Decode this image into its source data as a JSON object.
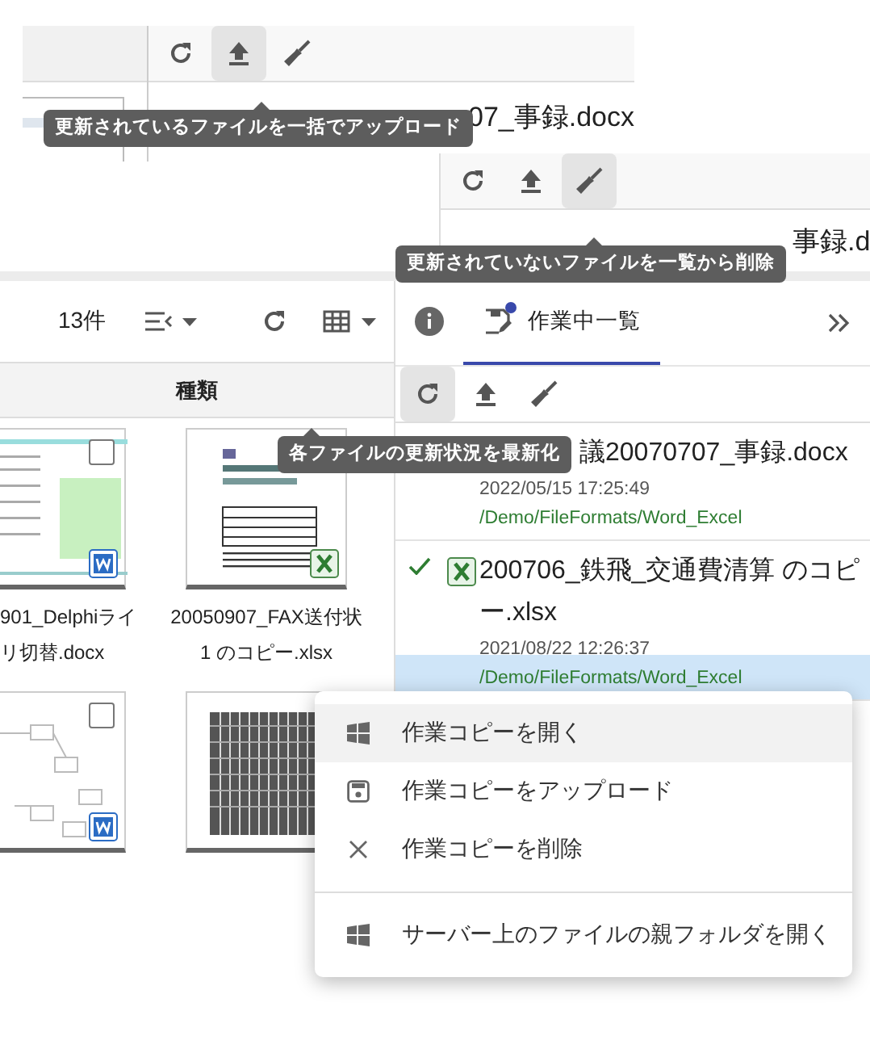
{
  "upload_panel": {
    "toolbar": [
      {
        "kind": "refresh",
        "hovered": false
      },
      {
        "kind": "upload",
        "hovered": true
      },
      {
        "kind": "clean",
        "hovered": false
      }
    ],
    "row_name": "07_事録.docx",
    "tooltip": "更新されているファイルを一括でアップロード"
  },
  "clean_panel": {
    "toolbar": [
      {
        "kind": "refresh",
        "hovered": false
      },
      {
        "kind": "upload",
        "hovered": false
      },
      {
        "kind": "clean",
        "hovered": true
      }
    ],
    "row_name": "事録.d",
    "tooltip": "更新されていないファイルを一覧から削除"
  },
  "file_browser": {
    "count": "13件",
    "column_header": "種類",
    "files": [
      {
        "name_lines": [
          "901_Delphiライ",
          "リ切替.docx"
        ],
        "kind": "word_document",
        "checked": false
      },
      {
        "name_lines": [
          "20050907_FAX送付状",
          "1 のコピー.xlsx"
        ],
        "kind": "excel_form"
      },
      {
        "kind": "word_diagram",
        "checked": false
      },
      {
        "kind": "spreadsheet"
      }
    ]
  },
  "side_panel": {
    "tabs": [
      {
        "kind": "info",
        "selected": false,
        "badge": false
      },
      {
        "kind": "working",
        "label": "作業中一覧",
        "selected": true,
        "badge": true
      }
    ],
    "toolbar": [
      {
        "kind": "refresh",
        "hovered": true
      },
      {
        "kind": "upload",
        "hovered": false
      },
      {
        "kind": "clean",
        "hovered": false
      }
    ],
    "tooltip": "各ファイルの更新状況を最新化",
    "files": [
      {
        "name": "議20070707_事録.docx",
        "date": "2022/05/15 17:25:49",
        "path": "/Demo/FileFormats/Word_Excel",
        "selected": false
      },
      {
        "name": "200706_鉄飛_交通費清算 のコピー.xlsx",
        "kind": "excel",
        "synced": true,
        "date": "2021/08/22 12:26:37",
        "path": "/Demo/FileFormats/Word_Excel",
        "selected": true
      }
    ]
  },
  "context_menu": [
    {
      "kind": "windows",
      "label": "作業コピーを開く",
      "hovered": true,
      "separated": false
    },
    {
      "kind": "save",
      "label": "作業コピーをアップロード",
      "hovered": false,
      "separated": false
    },
    {
      "kind": "delete",
      "label": "作業コピーを削除",
      "hovered": false,
      "separated": false
    },
    {
      "kind": "windows",
      "label": "サーバー上のファイルの親フォルダを開く",
      "hovered": false,
      "separated": true
    }
  ]
}
